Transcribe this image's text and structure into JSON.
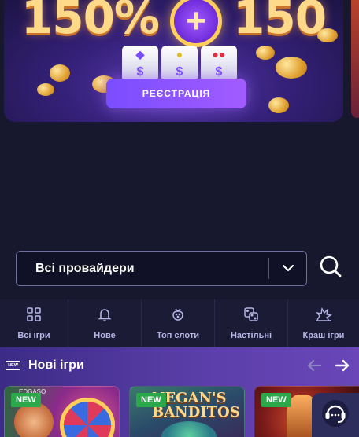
{
  "banner": {
    "promo_left": "150%",
    "promo_plus": "+",
    "promo_right": "150",
    "register_label": "РЕЄСТРАЦІЯ",
    "reel_symbols": [
      "$",
      "$",
      "$"
    ]
  },
  "filters": {
    "provider_value": "Всі провайдери"
  },
  "tabs": [
    {
      "label": "Всі ігри",
      "icon": "grid-icon"
    },
    {
      "label": "Нове",
      "icon": "bell-icon"
    },
    {
      "label": "Топ слоти",
      "icon": "strawberry-icon"
    },
    {
      "label": "Настільні",
      "icon": "dice-icon"
    },
    {
      "label": "Краш ігри",
      "icon": "explosion-icon"
    }
  ],
  "new_games": {
    "title": "Нові ігри",
    "badge_icon_text": "NEW",
    "games": [
      {
        "badge": "NEW",
        "art_text": "EDGASO"
      },
      {
        "badge": "NEW",
        "art_text": "NEGAN'S\nBANDITOS"
      },
      {
        "badge": "NEW",
        "art_text": ""
      }
    ]
  },
  "colors": {
    "accent": "#8a5cff",
    "new_badge": "#2aa84a",
    "background": "#17172e"
  }
}
